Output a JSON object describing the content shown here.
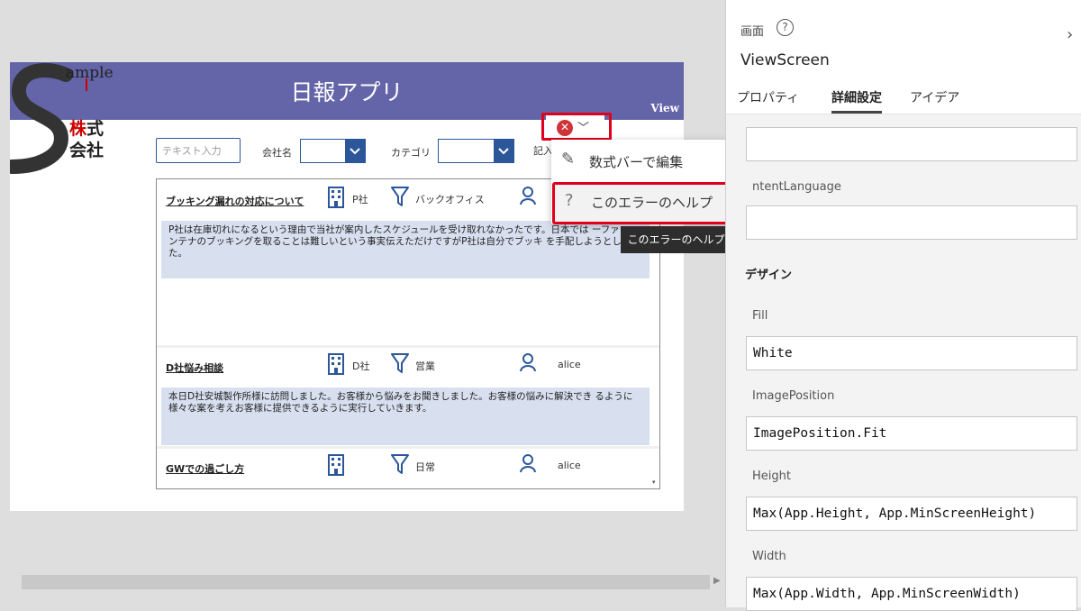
{
  "app": {
    "title": "日報アプリ",
    "view_label": "View",
    "logo": {
      "line1": "ample",
      "line2": "株式",
      "line3": "会社"
    },
    "search_placeholder": "テキスト入力",
    "filter_company_label": "会社名",
    "filter_category_label": "カテゴリ",
    "filter_writer_label": "記入",
    "items": [
      {
        "title": "ブッキング漏れの対応について",
        "company": "P社",
        "category": "バックオフィス",
        "user": "",
        "body": "P社は在庫切れになるという理由で当社が案内したスケジュールを受け取れなかったです。日本では ーファーコンテナのブッキングを取ることは難しいという事実伝えただけですがP社は自分でブッキ を手配しようとしました。"
      },
      {
        "title": "D社悩み相談",
        "company": "D社",
        "category": "営業",
        "user": "alice",
        "body": "本日D社安城製作所様に訪問しました。お客様から悩みをお聞きしました。お客様の悩みに解決でき るように様々な案を考えお客様に提供できるように実行していきます。"
      },
      {
        "title": "GWでの過ごし方",
        "company": "",
        "category": "日常",
        "user": "alice",
        "body": ""
      }
    ]
  },
  "error_menu": {
    "items": [
      "数式バーで編集",
      "このエラーのヘルプ"
    ],
    "tooltip": "このエラーのヘルプ"
  },
  "panel": {
    "kind": "画面",
    "name": "ViewScreen",
    "tabs": [
      "プロパティ",
      "詳細設定",
      "アイデア"
    ],
    "active_tab": "詳細設定",
    "content_language_label": "ContentLanguage",
    "content_language_label_visible": "ntentLanguage",
    "design_heading": "デザイン",
    "fill_label": "Fill",
    "fill_value": "White",
    "image_position_label": "ImagePosition",
    "image_position_value": "ImagePosition.Fit",
    "height_label": "Height",
    "height_value": "Max(App.Height, App.MinScreenHeight)",
    "width_label": "Width",
    "width_value": "Max(App.Width, App.MinScreenWidth)"
  },
  "colors": {
    "header": "#6464a8",
    "accent": "#2b579a",
    "error": "#d13438",
    "highlight": "#e0001a",
    "body_bg": "#d8e0f0"
  }
}
